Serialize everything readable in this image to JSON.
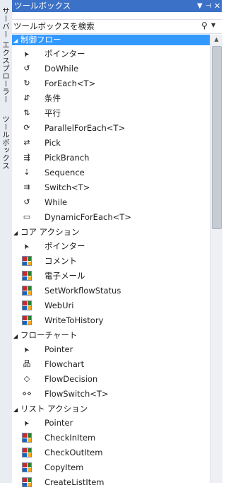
{
  "side_tabs": {
    "server_explorer": "サーバー エクスプローラー",
    "toolbox": "ツールボックス"
  },
  "panel": {
    "title": "ツールボックス",
    "search_placeholder": "ツールボックスを検索"
  },
  "categories": [
    {
      "label": "制御フロー",
      "selected": true,
      "items": [
        {
          "label": "ポインター",
          "icon": "pointer-icon"
        },
        {
          "label": "DoWhile",
          "icon": "dowhile-icon"
        },
        {
          "label": "ForEach<T>",
          "icon": "foreach-icon"
        },
        {
          "label": "条件",
          "icon": "if-icon"
        },
        {
          "label": "平行",
          "icon": "parallel-icon"
        },
        {
          "label": "ParallelForEach<T>",
          "icon": "parallelforeach-icon"
        },
        {
          "label": "Pick",
          "icon": "pick-icon"
        },
        {
          "label": "PickBranch",
          "icon": "pickbranch-icon"
        },
        {
          "label": "Sequence",
          "icon": "sequence-icon"
        },
        {
          "label": "Switch<T>",
          "icon": "switch-icon"
        },
        {
          "label": "While",
          "icon": "while-icon"
        },
        {
          "label": "DynamicForEach<T>",
          "icon": "dynamicforeach-icon"
        }
      ]
    },
    {
      "label": "コア アクション",
      "selected": false,
      "items": [
        {
          "label": "ポインター",
          "icon": "pointer-icon"
        },
        {
          "label": "コメント",
          "icon": "activity-grid-icon"
        },
        {
          "label": "電子メール",
          "icon": "activity-grid-icon"
        },
        {
          "label": "SetWorkflowStatus",
          "icon": "activity-grid-icon"
        },
        {
          "label": "WebUri",
          "icon": "activity-grid-icon"
        },
        {
          "label": "WriteToHistory",
          "icon": "activity-grid-icon"
        }
      ]
    },
    {
      "label": "フローチャート",
      "selected": false,
      "items": [
        {
          "label": "Pointer",
          "icon": "pointer-icon"
        },
        {
          "label": "Flowchart",
          "icon": "flowchart-icon"
        },
        {
          "label": "FlowDecision",
          "icon": "flowdecision-icon"
        },
        {
          "label": "FlowSwitch<T>",
          "icon": "flowswitch-icon"
        }
      ]
    },
    {
      "label": "リスト アクション",
      "selected": false,
      "items": [
        {
          "label": "Pointer",
          "icon": "pointer-icon"
        },
        {
          "label": "CheckInItem",
          "icon": "activity-grid-icon"
        },
        {
          "label": "CheckOutItem",
          "icon": "activity-grid-icon"
        },
        {
          "label": "CopyItem",
          "icon": "activity-grid-icon"
        },
        {
          "label": "CreateListItem",
          "icon": "activity-grid-icon"
        }
      ]
    }
  ]
}
